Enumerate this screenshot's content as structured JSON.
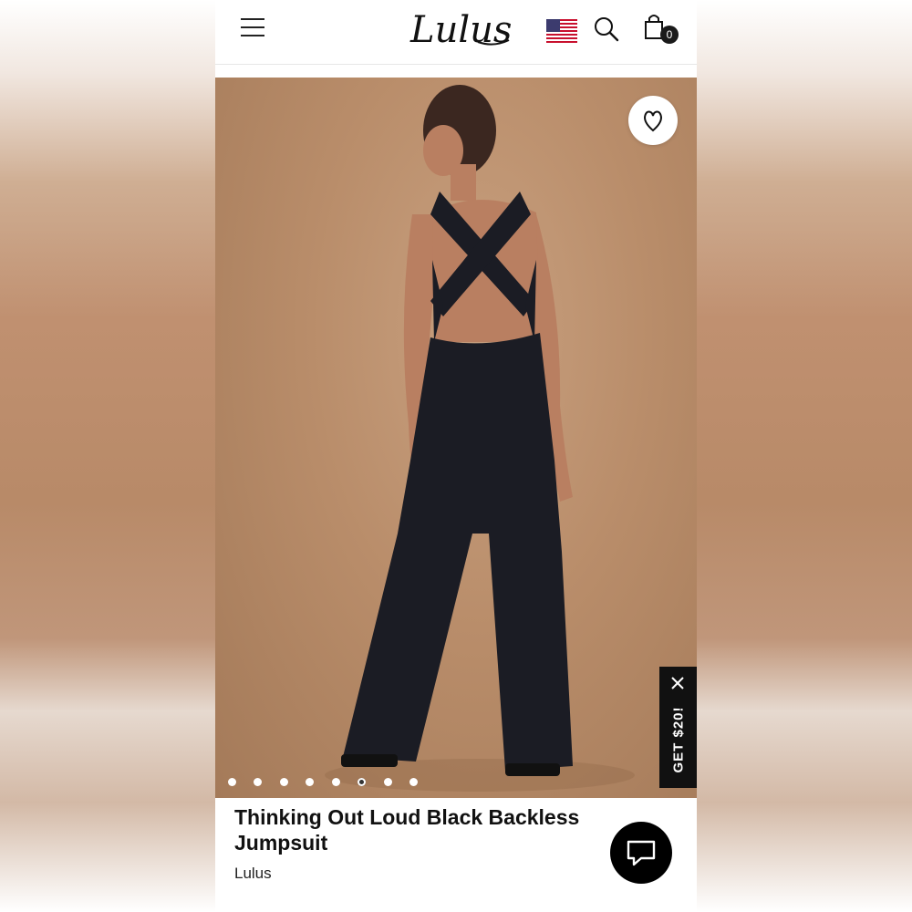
{
  "header": {
    "logo_text": "Lulus",
    "cart_count": "0",
    "icons": [
      "menu-icon",
      "us-flag-icon",
      "search-icon",
      "shopping-bag-icon"
    ]
  },
  "gallery": {
    "image_count": 8,
    "active_index": 5,
    "favorite_icon": "heart-icon"
  },
  "promo": {
    "label": "GET $20!",
    "close_icon": "close-icon"
  },
  "product": {
    "title": "Thinking Out Loud Black Backless Jumpsuit",
    "brand": "Lulus"
  },
  "chat": {
    "icon": "chat-bubble-icon"
  },
  "colors": {
    "accent": "#111111",
    "background": "#ffffff",
    "hero_bg": "#b98d6a"
  }
}
